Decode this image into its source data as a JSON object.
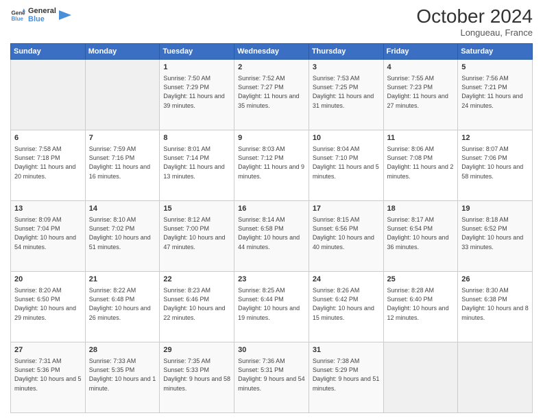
{
  "header": {
    "logo_line1": "General",
    "logo_line2": "Blue",
    "month_title": "October 2024",
    "location": "Longueau, France"
  },
  "days_of_week": [
    "Sunday",
    "Monday",
    "Tuesday",
    "Wednesday",
    "Thursday",
    "Friday",
    "Saturday"
  ],
  "weeks": [
    [
      {
        "num": "",
        "info": ""
      },
      {
        "num": "",
        "info": ""
      },
      {
        "num": "1",
        "info": "Sunrise: 7:50 AM\nSunset: 7:29 PM\nDaylight: 11 hours and 39 minutes."
      },
      {
        "num": "2",
        "info": "Sunrise: 7:52 AM\nSunset: 7:27 PM\nDaylight: 11 hours and 35 minutes."
      },
      {
        "num": "3",
        "info": "Sunrise: 7:53 AM\nSunset: 7:25 PM\nDaylight: 11 hours and 31 minutes."
      },
      {
        "num": "4",
        "info": "Sunrise: 7:55 AM\nSunset: 7:23 PM\nDaylight: 11 hours and 27 minutes."
      },
      {
        "num": "5",
        "info": "Sunrise: 7:56 AM\nSunset: 7:21 PM\nDaylight: 11 hours and 24 minutes."
      }
    ],
    [
      {
        "num": "6",
        "info": "Sunrise: 7:58 AM\nSunset: 7:18 PM\nDaylight: 11 hours and 20 minutes."
      },
      {
        "num": "7",
        "info": "Sunrise: 7:59 AM\nSunset: 7:16 PM\nDaylight: 11 hours and 16 minutes."
      },
      {
        "num": "8",
        "info": "Sunrise: 8:01 AM\nSunset: 7:14 PM\nDaylight: 11 hours and 13 minutes."
      },
      {
        "num": "9",
        "info": "Sunrise: 8:03 AM\nSunset: 7:12 PM\nDaylight: 11 hours and 9 minutes."
      },
      {
        "num": "10",
        "info": "Sunrise: 8:04 AM\nSunset: 7:10 PM\nDaylight: 11 hours and 5 minutes."
      },
      {
        "num": "11",
        "info": "Sunrise: 8:06 AM\nSunset: 7:08 PM\nDaylight: 11 hours and 2 minutes."
      },
      {
        "num": "12",
        "info": "Sunrise: 8:07 AM\nSunset: 7:06 PM\nDaylight: 10 hours and 58 minutes."
      }
    ],
    [
      {
        "num": "13",
        "info": "Sunrise: 8:09 AM\nSunset: 7:04 PM\nDaylight: 10 hours and 54 minutes."
      },
      {
        "num": "14",
        "info": "Sunrise: 8:10 AM\nSunset: 7:02 PM\nDaylight: 10 hours and 51 minutes."
      },
      {
        "num": "15",
        "info": "Sunrise: 8:12 AM\nSunset: 7:00 PM\nDaylight: 10 hours and 47 minutes."
      },
      {
        "num": "16",
        "info": "Sunrise: 8:14 AM\nSunset: 6:58 PM\nDaylight: 10 hours and 44 minutes."
      },
      {
        "num": "17",
        "info": "Sunrise: 8:15 AM\nSunset: 6:56 PM\nDaylight: 10 hours and 40 minutes."
      },
      {
        "num": "18",
        "info": "Sunrise: 8:17 AM\nSunset: 6:54 PM\nDaylight: 10 hours and 36 minutes."
      },
      {
        "num": "19",
        "info": "Sunrise: 8:18 AM\nSunset: 6:52 PM\nDaylight: 10 hours and 33 minutes."
      }
    ],
    [
      {
        "num": "20",
        "info": "Sunrise: 8:20 AM\nSunset: 6:50 PM\nDaylight: 10 hours and 29 minutes."
      },
      {
        "num": "21",
        "info": "Sunrise: 8:22 AM\nSunset: 6:48 PM\nDaylight: 10 hours and 26 minutes."
      },
      {
        "num": "22",
        "info": "Sunrise: 8:23 AM\nSunset: 6:46 PM\nDaylight: 10 hours and 22 minutes."
      },
      {
        "num": "23",
        "info": "Sunrise: 8:25 AM\nSunset: 6:44 PM\nDaylight: 10 hours and 19 minutes."
      },
      {
        "num": "24",
        "info": "Sunrise: 8:26 AM\nSunset: 6:42 PM\nDaylight: 10 hours and 15 minutes."
      },
      {
        "num": "25",
        "info": "Sunrise: 8:28 AM\nSunset: 6:40 PM\nDaylight: 10 hours and 12 minutes."
      },
      {
        "num": "26",
        "info": "Sunrise: 8:30 AM\nSunset: 6:38 PM\nDaylight: 10 hours and 8 minutes."
      }
    ],
    [
      {
        "num": "27",
        "info": "Sunrise: 7:31 AM\nSunset: 5:36 PM\nDaylight: 10 hours and 5 minutes."
      },
      {
        "num": "28",
        "info": "Sunrise: 7:33 AM\nSunset: 5:35 PM\nDaylight: 10 hours and 1 minute."
      },
      {
        "num": "29",
        "info": "Sunrise: 7:35 AM\nSunset: 5:33 PM\nDaylight: 9 hours and 58 minutes."
      },
      {
        "num": "30",
        "info": "Sunrise: 7:36 AM\nSunset: 5:31 PM\nDaylight: 9 hours and 54 minutes."
      },
      {
        "num": "31",
        "info": "Sunrise: 7:38 AM\nSunset: 5:29 PM\nDaylight: 9 hours and 51 minutes."
      },
      {
        "num": "",
        "info": ""
      },
      {
        "num": "",
        "info": ""
      }
    ]
  ]
}
